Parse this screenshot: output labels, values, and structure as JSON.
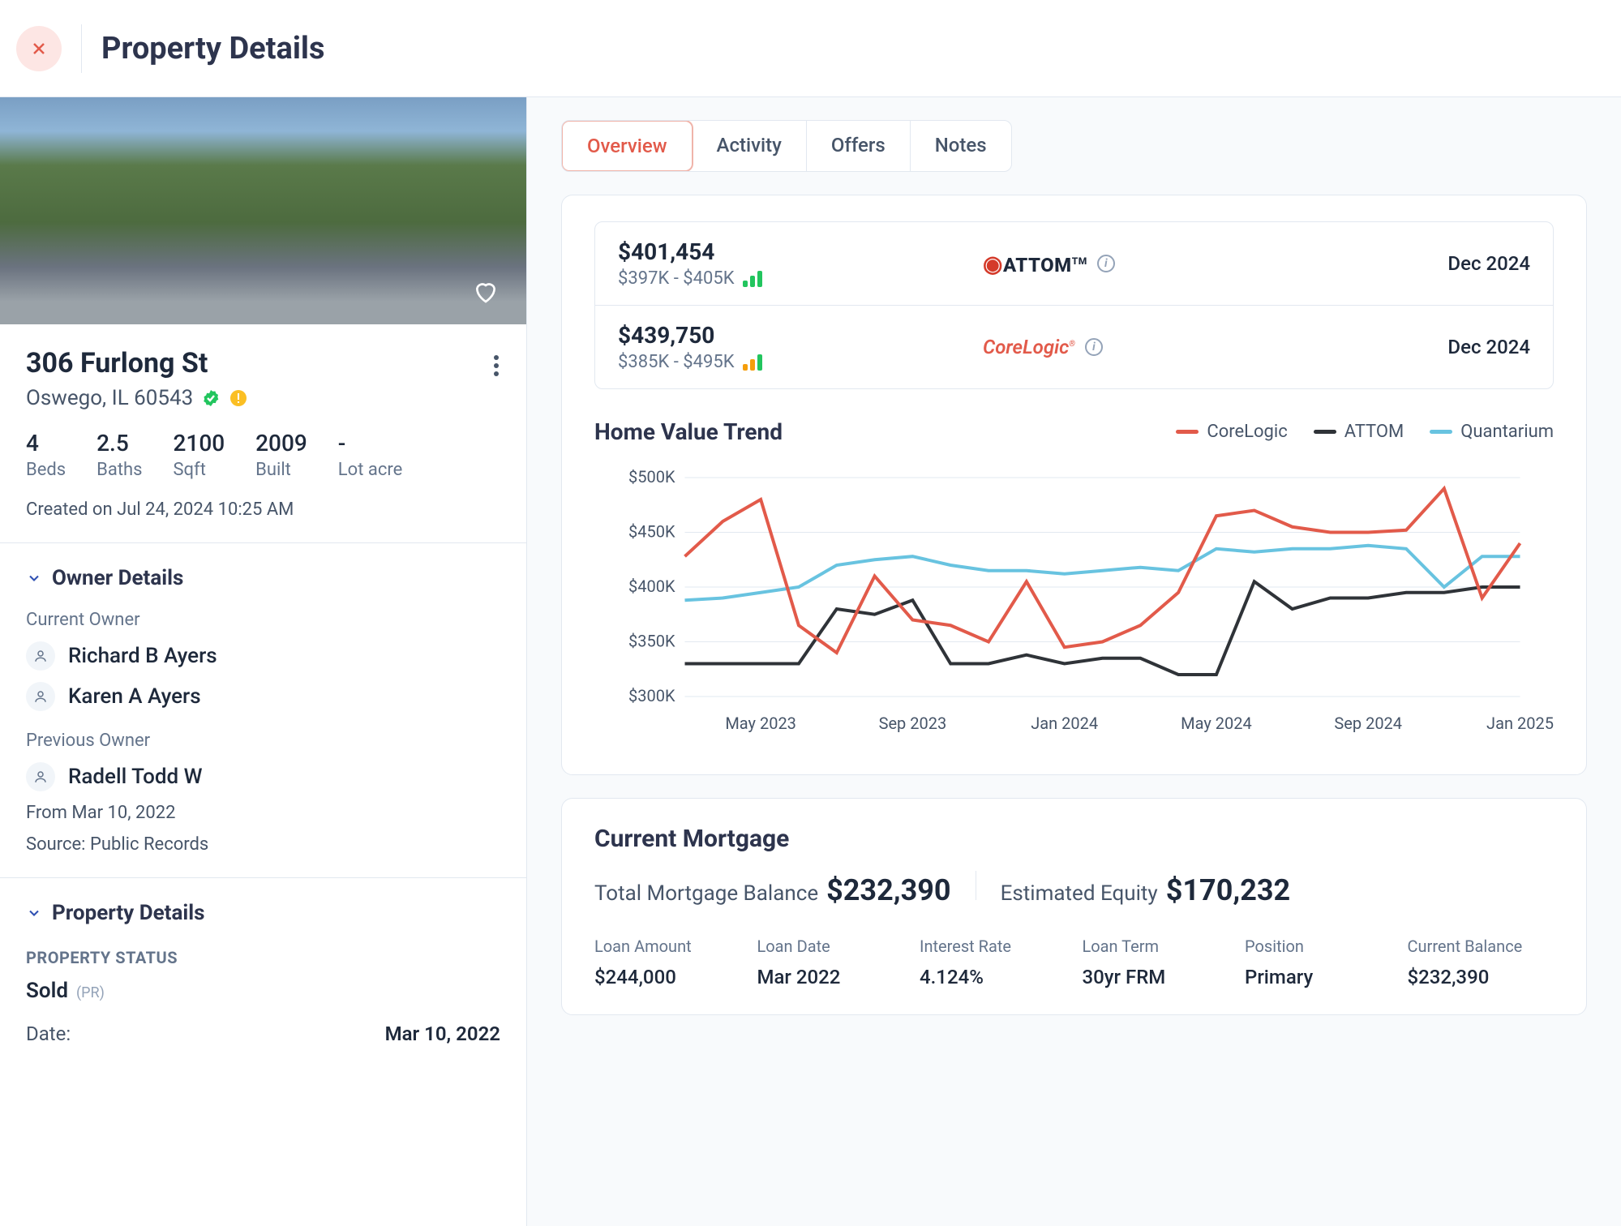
{
  "header": {
    "title": "Property Details"
  },
  "property": {
    "street": "306 Furlong St",
    "citystate": "Oswego, IL 60543",
    "stats": {
      "beds": {
        "val": "4",
        "lab": "Beds"
      },
      "baths": {
        "val": "2.5",
        "lab": "Baths"
      },
      "sqft": {
        "val": "2100",
        "lab": "Sqft"
      },
      "built": {
        "val": "2009",
        "lab": "Built"
      },
      "lot": {
        "val": "-",
        "lab": "Lot acre"
      }
    },
    "created": "Created on Jul 24, 2024 10:25 AM"
  },
  "owners": {
    "section_title": "Owner Details",
    "current_label": "Current Owner",
    "current": [
      "Richard B Ayers",
      "Karen A Ayers"
    ],
    "previous_label": "Previous Owner",
    "previous": [
      "Radell Todd W"
    ],
    "from": "From Mar 10, 2022",
    "source": "Source: Public Records"
  },
  "details": {
    "section_title": "Property Details",
    "status_label": "PROPERTY STATUS",
    "status_val": "Sold",
    "status_tag": "(PR)",
    "date_label": "Date:",
    "date_val": "Mar 10, 2022"
  },
  "tabs": {
    "overview": "Overview",
    "activity": "Activity",
    "offers": "Offers",
    "notes": "Notes"
  },
  "valuations": [
    {
      "value": "$401,454",
      "range": "$397K - $405K",
      "source": "ATTOM",
      "date": "Dec 2024",
      "signal": "green"
    },
    {
      "value": "$439,750",
      "range": "$385K - $495K",
      "source": "CoreLogic",
      "date": "Dec 2024",
      "signal": "mix"
    }
  ],
  "trend": {
    "title": "Home Value Trend",
    "legend": {
      "corelogic": "CoreLogic",
      "attom": "ATTOM",
      "quantarium": "Quantarium"
    }
  },
  "chart_data": {
    "type": "line",
    "title": "Home Value Trend",
    "xlabel": "",
    "ylabel": "",
    "ylim": [
      300000,
      500000
    ],
    "y_ticks": [
      "$300K",
      "$350K",
      "$400K",
      "$450K",
      "$500K"
    ],
    "x_ticks": [
      "May 2023",
      "Sep 2023",
      "Jan 2024",
      "May 2024",
      "Sep 2024",
      "Jan 2025"
    ],
    "x": [
      "Mar 2023",
      "Apr 2023",
      "May 2023",
      "Jun 2023",
      "Jul 2023",
      "Aug 2023",
      "Sep 2023",
      "Oct 2023",
      "Nov 2023",
      "Dec 2023",
      "Jan 2024",
      "Feb 2024",
      "Mar 2024",
      "Apr 2024",
      "May 2024",
      "Jun 2024",
      "Jul 2024",
      "Aug 2024",
      "Sep 2024",
      "Oct 2024",
      "Nov 2024",
      "Dec 2024",
      "Jan 2025"
    ],
    "series": [
      {
        "name": "CoreLogic",
        "color": "#e25a4a",
        "values": [
          428000,
          460000,
          480000,
          365000,
          340000,
          410000,
          370000,
          365000,
          350000,
          405000,
          345000,
          350000,
          365000,
          395000,
          465000,
          470000,
          455000,
          450000,
          450000,
          452000,
          490000,
          390000,
          440000
        ]
      },
      {
        "name": "ATTOM",
        "color": "#2f3338",
        "values": [
          330000,
          330000,
          330000,
          330000,
          380000,
          375000,
          388000,
          330000,
          330000,
          338000,
          330000,
          335000,
          335000,
          320000,
          320000,
          405000,
          380000,
          390000,
          390000,
          395000,
          395000,
          400000,
          400000
        ]
      },
      {
        "name": "Quantarium",
        "color": "#68c3e0",
        "values": [
          388000,
          390000,
          395000,
          400000,
          420000,
          425000,
          428000,
          420000,
          415000,
          415000,
          412000,
          415000,
          418000,
          415000,
          435000,
          432000,
          435000,
          435000,
          438000,
          435000,
          400000,
          428000,
          428000
        ]
      }
    ]
  },
  "mortgage": {
    "title": "Current Mortgage",
    "balance_label": "Total Mortgage Balance",
    "balance_val": "$232,390",
    "equity_label": "Estimated Equity",
    "equity_val": "$170,232",
    "cols": {
      "amount": {
        "h": "Loan Amount",
        "v": "$244,000"
      },
      "date": {
        "h": "Loan Date",
        "v": "Mar 2022"
      },
      "rate": {
        "h": "Interest Rate",
        "v": "4.124%"
      },
      "term": {
        "h": "Loan Term",
        "v": "30yr FRM"
      },
      "position": {
        "h": "Position",
        "v": "Primary"
      },
      "curbal": {
        "h": "Current Balance",
        "v": "$232,390"
      }
    }
  }
}
